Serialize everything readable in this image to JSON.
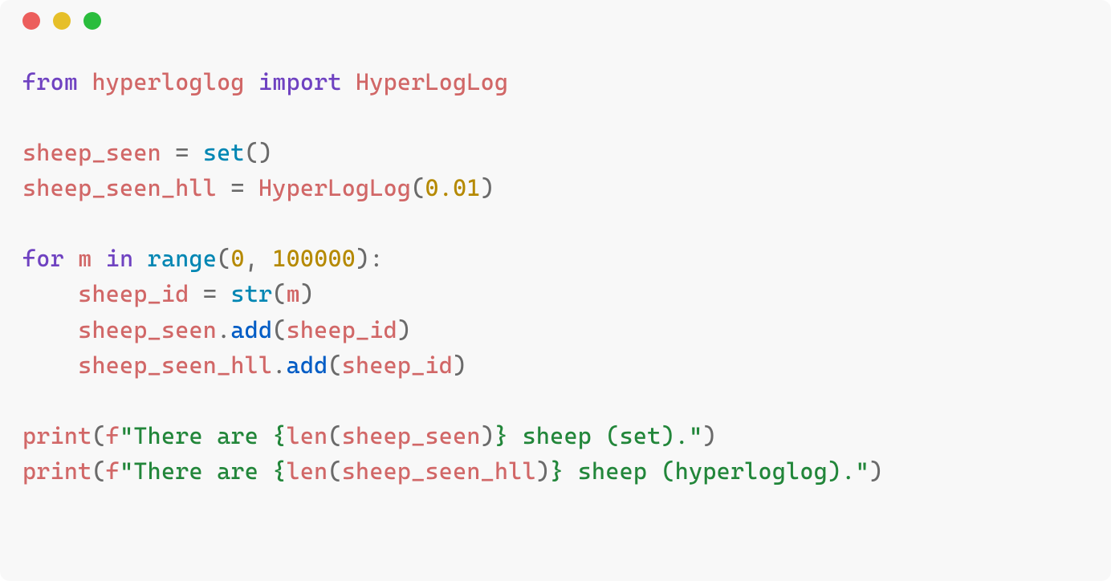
{
  "window": {
    "dots": {
      "red": "#EC5E5C",
      "yellow": "#E6BF29",
      "green": "#2ABD3D"
    }
  },
  "code": {
    "t_from": "from",
    "t_hyperloglog_mod": "hyperloglog",
    "t_import": "import",
    "t_HyperLogLog": "HyperLogLog",
    "t_sheep_seen": "sheep_seen",
    "t_eq": "=",
    "t_set": "set",
    "t_parens_empty": "()",
    "t_sheep_seen_hll": "sheep_seen_hll",
    "t_num_001": "0.01",
    "t_lparen": "(",
    "t_rparen": ")",
    "t_for": "for",
    "t_m": "m",
    "t_in": "in",
    "t_range": "range",
    "t_num_0": "0",
    "t_comma": ",",
    "t_num_100000": "100000",
    "t_colon": ":",
    "t_sheep_id": "sheep_id",
    "t_str": "str",
    "t_dot": ".",
    "t_add": "add",
    "t_print": "print",
    "t_fprefix": "f",
    "t_quote": "\"",
    "t_str_there_are": "There are ",
    "t_lbrace": "{",
    "t_rbrace": "}",
    "t_len": "len",
    "t_str_sheep_set": " sheep (set).",
    "t_str_sheep_hll": " sheep (hyperloglog).",
    "t_space": " ",
    "t_indent": "    "
  }
}
